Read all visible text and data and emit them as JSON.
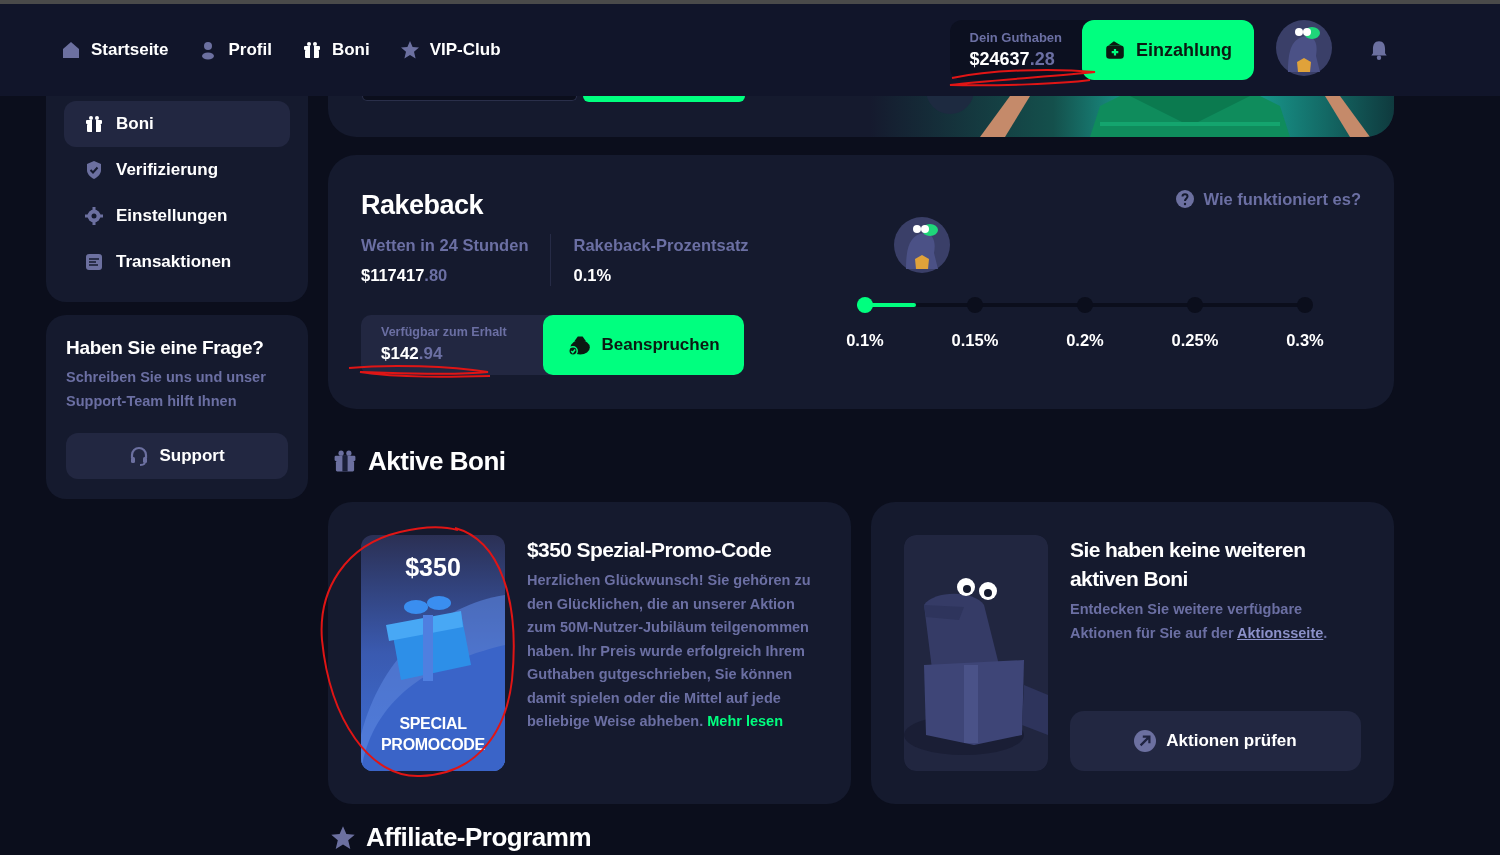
{
  "header": {
    "nav": [
      {
        "label": "Startseite"
      },
      {
        "label": "Profil"
      },
      {
        "label": "Boni"
      },
      {
        "label": "VIP-Club"
      }
    ],
    "balance": {
      "label": "Dein Guthaben",
      "amount_whole": "$24637",
      "amount_cents": ".28"
    },
    "deposit_button": "Einzahlung"
  },
  "sidebar": {
    "items": [
      {
        "label": "Boni",
        "selected": true
      },
      {
        "label": "Verifizierung",
        "selected": false
      },
      {
        "label": "Einstellungen",
        "selected": false
      },
      {
        "label": "Transaktionen",
        "selected": false
      }
    ],
    "help": {
      "title": "Haben Sie eine Frage?",
      "text": "Schreiben Sie uns und unser Support-Team hilft Ihnen",
      "button": "Support"
    }
  },
  "rakeback": {
    "title": "Rakeback",
    "help_link": "Wie funktioniert es?",
    "stats": [
      {
        "label": "Wetten in 24 Stunden",
        "value_whole": "$117417",
        "value_cents": ".80"
      },
      {
        "label": "Rakeback-Prozentsatz",
        "value_whole": "0.1%"
      }
    ],
    "claim": {
      "label": "Verfügbar zum Erhalt",
      "amount_whole": "$142",
      "amount_cents": ".94"
    },
    "claim_button": "Beanspruchen",
    "progress": {
      "level": 0.13,
      "steps": [
        {
          "label": "0.1%",
          "reached": true
        },
        {
          "label": "0.15%",
          "reached": false
        },
        {
          "label": "0.2%",
          "reached": false
        },
        {
          "label": "0.25%",
          "reached": false
        },
        {
          "label": "0.3%",
          "reached": false
        }
      ]
    }
  },
  "active_bonuses": {
    "title": "Aktive Boni",
    "cards": [
      {
        "kind": "promo",
        "badge_amount": "$350",
        "badge_text": "SPECIAL PROMOCODE",
        "title": "$350 Spezial-Promo-Code",
        "text": "Herzlichen Glückwunsch! Sie gehören zu den Glücklichen, die an unserer Aktion zum 50M-Nutzer-Jubiläum teilgenommen haben. Ihr Preis wurde erfolgreich Ihrem Guthaben gutgeschrieben, Sie können damit spielen oder die Mittel auf jede beliebige Weise abheben.",
        "link": "Mehr lesen"
      },
      {
        "kind": "empty",
        "title": "Sie haben keine weiteren aktiven Boni",
        "text": "Entdecken Sie weitere verfügbare Aktionen für Sie auf der",
        "link": "Aktionsseite",
        "text_after": ".",
        "button": "Aktionen prüfen"
      }
    ]
  },
  "next_section": {
    "title": "Affiliate-Programm"
  }
}
